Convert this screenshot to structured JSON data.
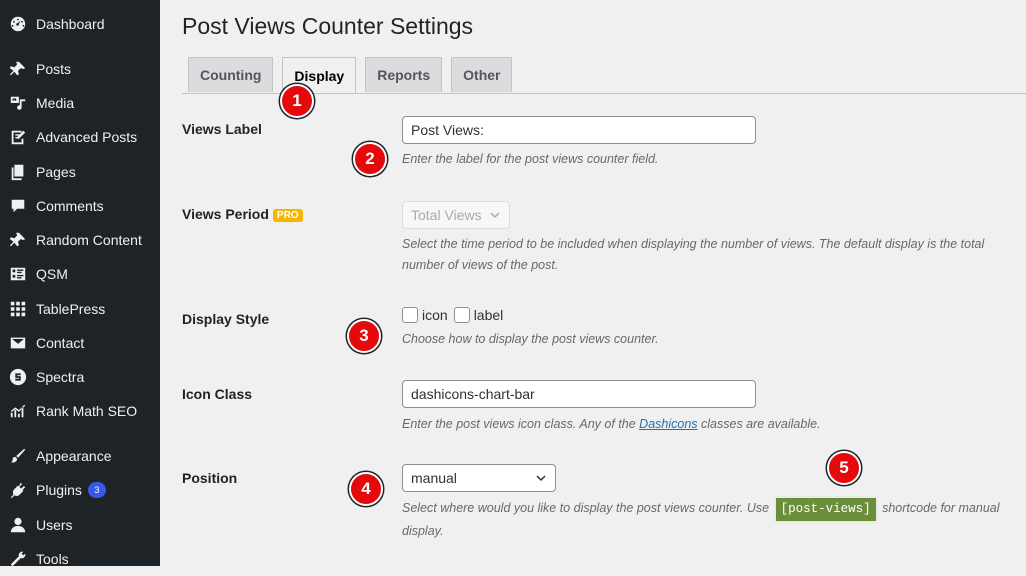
{
  "sidebar": {
    "items": [
      {
        "label": "Dashboard",
        "icon": "dashboard-icon"
      },
      {
        "label": "Posts",
        "icon": "pin-icon"
      },
      {
        "label": "Media",
        "icon": "media-icon"
      },
      {
        "label": "Advanced Posts",
        "icon": "edit-page-icon"
      },
      {
        "label": "Pages",
        "icon": "pages-icon"
      },
      {
        "label": "Comments",
        "icon": "comment-icon"
      },
      {
        "label": "Random Content",
        "icon": "pin-icon"
      },
      {
        "label": "QSM",
        "icon": "list-icon"
      },
      {
        "label": "TablePress",
        "icon": "table-icon"
      },
      {
        "label": "Contact",
        "icon": "envelope-icon"
      },
      {
        "label": "Spectra",
        "icon": "spectra-icon"
      },
      {
        "label": "Rank Math SEO",
        "icon": "chart-icon"
      },
      {
        "label": "Appearance",
        "icon": "brush-icon"
      },
      {
        "label": "Plugins",
        "icon": "plug-icon",
        "badge": "3"
      },
      {
        "label": "Users",
        "icon": "user-icon"
      },
      {
        "label": "Tools",
        "icon": "wrench-icon"
      }
    ]
  },
  "page": {
    "title": "Post Views Counter Settings",
    "tabs": [
      {
        "label": "Counting"
      },
      {
        "label": "Display"
      },
      {
        "label": "Reports"
      },
      {
        "label": "Other"
      }
    ]
  },
  "settings": {
    "views_label": {
      "label": "Views Label",
      "value": "Post Views:",
      "desc": "Enter the label for the post views counter field."
    },
    "views_period": {
      "label": "Views Period",
      "badge": "PRO",
      "value": "Total Views",
      "desc": "Select the time period to be included when displaying the number of views. The default display is the total number of views of the post."
    },
    "display_style": {
      "label": "Display Style",
      "option_icon": "icon",
      "option_label": "label",
      "desc": "Choose how to display the post views counter."
    },
    "icon_class": {
      "label": "Icon Class",
      "value": "dashicons-chart-bar",
      "desc_before": "Enter the post views icon class. Any of the",
      "desc_link": "Dashicons",
      "desc_after": "classes are available."
    },
    "position": {
      "label": "Position",
      "value": "manual",
      "desc_before": "Select where would you like to display the post views counter. Use",
      "shortcode": "[post-views]",
      "desc_after": "shortcode for manual display."
    }
  },
  "markers": [
    "1",
    "2",
    "3",
    "4",
    "5"
  ],
  "colors": {
    "sidebar_bg": "#1d2327",
    "marker_red": "#e5090b",
    "pro_badge": "#f7b500",
    "shortcode_bg": "#6b8e3a",
    "plugin_badge": "#3858e9"
  }
}
